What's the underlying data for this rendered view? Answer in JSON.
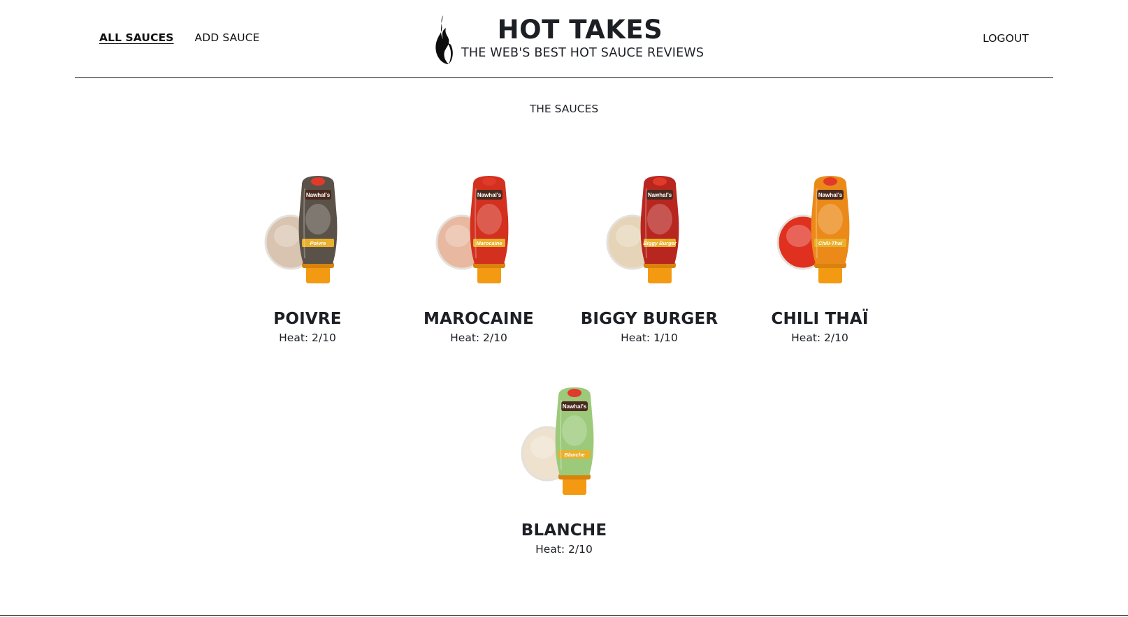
{
  "header": {
    "nav": {
      "all_sauces": "ALL SAUCES",
      "add_sauce": "ADD SAUCE",
      "logout": "LOGOUT"
    },
    "brand": {
      "title": "HOT TAKES",
      "subtitle": "THE WEB'S BEST HOT SAUCE REVIEWS"
    }
  },
  "main": {
    "section_title": "THE SAUCES",
    "sauces": [
      {
        "name": "POIVRE",
        "heat": "Heat: 2/10",
        "label": "Poivre",
        "bottle_color": "#5a5248",
        "sauce_color": "#d8c4b0",
        "image_icon": "sauce-bottle-image"
      },
      {
        "name": "MAROCAINE",
        "heat": "Heat: 2/10",
        "label": "Marocaine",
        "bottle_color": "#d3301f",
        "sauce_color": "#e8b8a0",
        "image_icon": "sauce-bottle-image"
      },
      {
        "name": "BIGGY BURGER",
        "heat": "Heat: 1/10",
        "label": "Biggy Burger",
        "bottle_color": "#b82620",
        "sauce_color": "#e6d4b8",
        "image_icon": "sauce-bottle-image"
      },
      {
        "name": "CHILI THAÏ",
        "heat": "Heat: 2/10",
        "label": "Chili-Thaï",
        "bottle_color": "#eb8a18",
        "sauce_color": "#e03020",
        "image_icon": "sauce-bottle-image"
      },
      {
        "name": "BLANCHE",
        "heat": "Heat: 2/10",
        "label": "Blanche",
        "bottle_color": "#9cc97a",
        "sauce_color": "#eee2cf",
        "image_icon": "sauce-bottle-image"
      }
    ],
    "bottle_brand": "Nawhal's"
  },
  "colors": {
    "text": "#1c1f24",
    "rule": "#111111",
    "cap": "#f39a12"
  }
}
